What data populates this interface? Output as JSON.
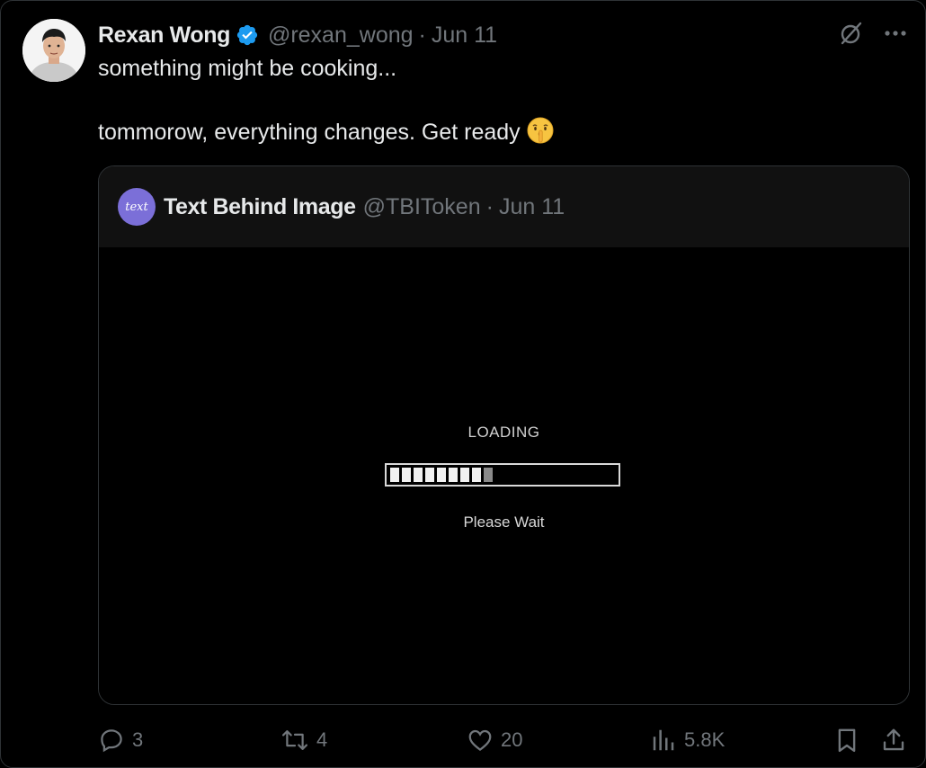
{
  "author": {
    "display_name": "Rexan Wong",
    "handle": "@rexan_wong",
    "separator": "·",
    "date": "Jun 11",
    "avatar_icon": "user-photo"
  },
  "tweet": {
    "lines": [
      "something might be cooking...",
      "tommorow, everything changes. Get ready"
    ],
    "emoji_icon": "shushing-face-emoji"
  },
  "quoted": {
    "display_name": "Text Behind Image",
    "handle": "@TBIToken",
    "separator": "·",
    "date": "Jun 11",
    "avatar_text": "text",
    "avatar_color": "#7b6fd8",
    "media": {
      "loading_label": "LOADING",
      "status_text": "Please Wait",
      "progress_segments_filled": 8,
      "progress_segments_partial": 1,
      "progress_fraction": 0.52
    }
  },
  "actions": {
    "replies": "3",
    "reposts": "4",
    "likes": "20",
    "views": "5.8K"
  },
  "colors": {
    "background": "#000000",
    "primary_text": "#e7e9ea",
    "secondary_text": "#71767b",
    "verified_badge": "#1d9bf0",
    "border": "#2f3336"
  }
}
